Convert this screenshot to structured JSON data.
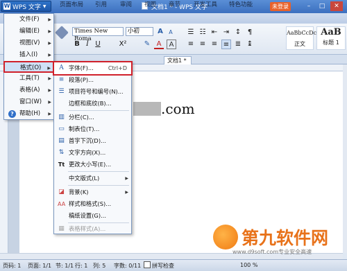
{
  "app": {
    "menu_button_label": "WPS 文字",
    "window_title": "文档1 * - WPS 文字",
    "login_label": "未登录",
    "window_controls": [
      "–",
      "□",
      "✕"
    ]
  },
  "ribbon_tabs": [
    "页面布局",
    "引用",
    "审阅",
    "视图",
    "章节",
    "开发工具",
    "特色功能"
  ],
  "ribbon": {
    "font_name": "Times New Roma",
    "font_size": "小初",
    "bold": "B",
    "italic": "I",
    "underline": "U",
    "style_normal_preview": "AaBbCcDc",
    "style_normal_label": "正文",
    "style_h1_preview": "AaB",
    "style_h1_label": "标题 1"
  },
  "document_tab": "文档1 *",
  "document": {
    "visible_text": ".com"
  },
  "main_menu": [
    {
      "label": "文件(F)",
      "has_submenu": true
    },
    {
      "label": "编辑(E)",
      "has_submenu": true
    },
    {
      "label": "视图(V)",
      "has_submenu": true
    },
    {
      "label": "插入(I)",
      "has_submenu": true
    },
    {
      "label": "格式(O)",
      "has_submenu": true,
      "highlighted": true
    },
    {
      "label": "工具(T)",
      "has_submenu": true
    },
    {
      "label": "表格(A)",
      "has_submenu": true
    },
    {
      "label": "窗口(W)",
      "has_submenu": true
    },
    {
      "label": "帮助(H)",
      "has_submenu": true
    }
  ],
  "format_submenu": [
    {
      "label": "字体(F)...",
      "shortcut": "Ctrl+D",
      "icon": "font-icon"
    },
    {
      "label": "段落(P)...",
      "icon": "paragraph-icon"
    },
    {
      "label": "项目符号和编号(N)...",
      "icon": "bullets-icon"
    },
    {
      "label": "边框和底纹(B)...",
      "icon": ""
    },
    {
      "label": "分栏(C)...",
      "icon": "columns-icon"
    },
    {
      "label": "制表位(T)...",
      "icon": "tab-stop-icon"
    },
    {
      "label": "首字下沉(D)...",
      "icon": "drop-cap-icon"
    },
    {
      "label": "文字方向(X)...",
      "icon": "text-direction-icon"
    },
    {
      "label": "更改大小写(E)...",
      "icon": "change-case-icon"
    },
    {
      "label": "中文版式(L)",
      "icon": "",
      "has_submenu": true
    },
    {
      "label": "背景(K)",
      "icon": "background-icon",
      "has_submenu": true
    },
    {
      "label": "样式和格式(S)...",
      "icon": "styles-icon"
    },
    {
      "label": "稿纸设置(G)...",
      "icon": ""
    },
    {
      "label": "表格样式(A)...",
      "icon": "table-style-icon",
      "disabled": true
    }
  ],
  "statusbar": {
    "page": "页码: 1",
    "pages": "页面: 1/1",
    "section": "节: 1/1",
    "line": "行: 1",
    "column": "列: 5",
    "word_count": "字数: 0/11",
    "spellcheck": "拼写检查",
    "zoom": "100 %"
  },
  "watermark": {
    "brand": "第九软件网",
    "url": "www.d9soft.com专业安全高速"
  }
}
